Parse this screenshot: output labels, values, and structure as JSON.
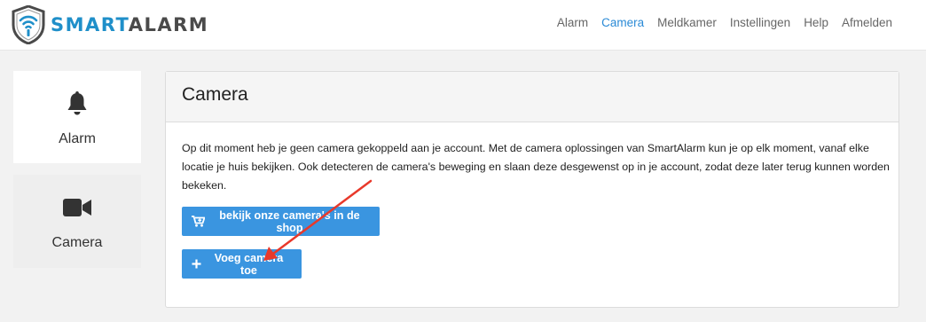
{
  "brand": {
    "name_part1": "SMART",
    "name_part2": "ALARM",
    "icon": "shield-wifi-logo"
  },
  "nav": {
    "items": [
      {
        "label": "Alarm",
        "active": false
      },
      {
        "label": "Camera",
        "active": true
      },
      {
        "label": "Meldkamer",
        "active": false
      },
      {
        "label": "Instellingen",
        "active": false
      },
      {
        "label": "Help",
        "active": false
      },
      {
        "label": "Afmelden",
        "active": false
      }
    ]
  },
  "sidebar": {
    "items": [
      {
        "label": "Alarm",
        "icon": "bell-icon"
      },
      {
        "label": "Camera",
        "icon": "video-camera-icon"
      }
    ]
  },
  "panel": {
    "title": "Camera",
    "text": "Op dit moment heb je geen camera gekoppeld aan je account. Met de camera oplossingen van SmartAlarm kun je op elk moment, vanaf elke locatie je huis bekijken. Ook detecteren de camera's beweging en slaan deze desgewenst op in je account, zodat deze later terug kunnen worden bekeken.",
    "shop_button": {
      "label": "bekijk onze camera's in de shop",
      "icon": "cart-plus-icon"
    },
    "add_button": {
      "label": "Voeg camera toe",
      "icon": "plus-icon"
    }
  },
  "colors": {
    "brand_blue": "#1f8fc9",
    "nav_active": "#2a8ad6",
    "button_blue": "#3a95e0",
    "annotation_arrow": "#e8392b"
  }
}
